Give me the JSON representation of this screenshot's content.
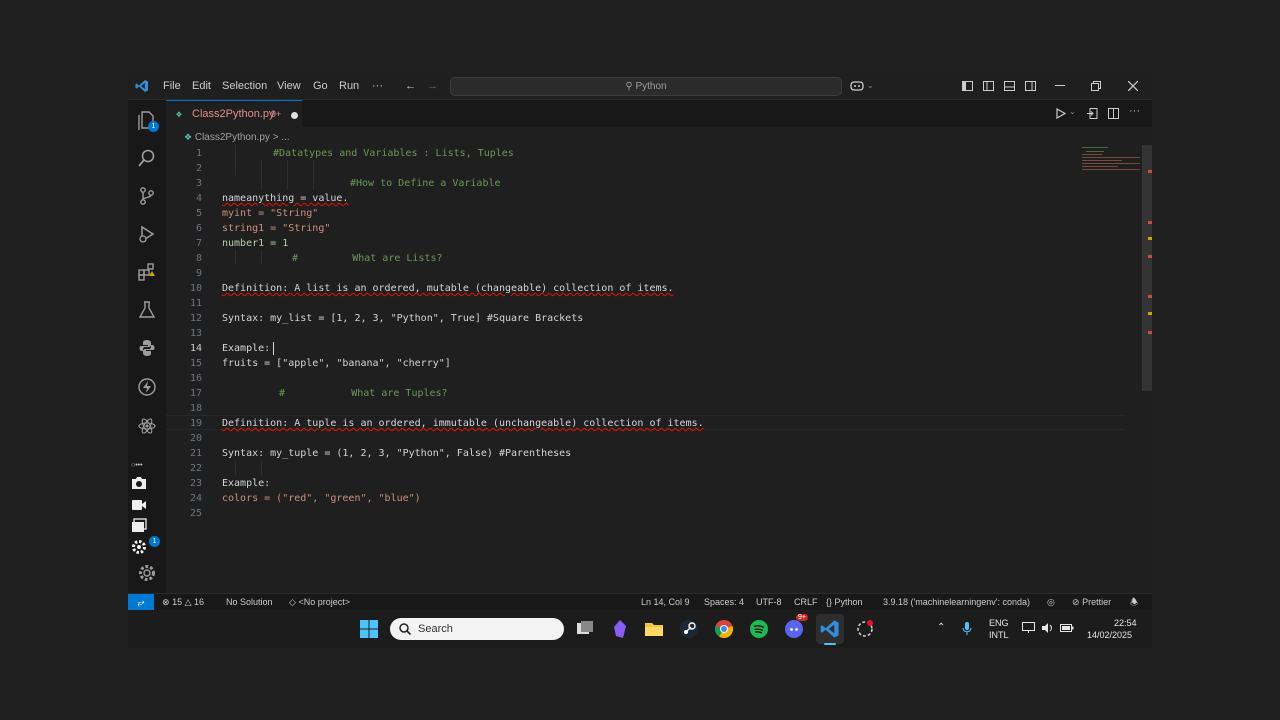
{
  "menu": {
    "items": [
      "File",
      "Edit",
      "Selection",
      "View",
      "Go",
      "Run",
      "···"
    ]
  },
  "command_center": {
    "text": "Python"
  },
  "activity": {
    "explorer_badge": "1",
    "settings_badge": "1"
  },
  "tab": {
    "name": "Class2Python.py",
    "meta": "9+"
  },
  "breadcrumb": {
    "file": "Class2Python.py",
    "rest": "> ..."
  },
  "editor": {
    "lines": [
      {
        "n": "1",
        "text": "#Datatypes and Variables : Lists, Tuples"
      },
      {
        "n": "2",
        "text": ""
      },
      {
        "n": "3",
        "text": "#How to Define a Variable"
      },
      {
        "n": "4",
        "text": "nameanything = value."
      },
      {
        "n": "5",
        "text": "myint = \"String\""
      },
      {
        "n": "6",
        "text": "string1 = \"String\""
      },
      {
        "n": "7",
        "text": "number1 = 1"
      },
      {
        "n": "8",
        "text": "#         What are Lists?"
      },
      {
        "n": "9",
        "text": ""
      },
      {
        "n": "10",
        "text": "Definition: A list is an ordered, mutable (changeable) collection of items."
      },
      {
        "n": "11",
        "text": ""
      },
      {
        "n": "12",
        "text": "Syntax: my_list = [1, 2, 3, \"Python\", True] #Square Brackets"
      },
      {
        "n": "13",
        "text": ""
      },
      {
        "n": "14",
        "text": "Example:"
      },
      {
        "n": "15",
        "text": "fruits = [\"apple\", \"banana\", \"cherry\"]"
      },
      {
        "n": "16",
        "text": ""
      },
      {
        "n": "17",
        "text": "#           What are Tuples?"
      },
      {
        "n": "18",
        "text": ""
      },
      {
        "n": "19",
        "text": "Definition: A tuple is an ordered, immutable (unchangeable) collection of items."
      },
      {
        "n": "20",
        "text": ""
      },
      {
        "n": "21",
        "text": "Syntax: my_tuple = (1, 2, 3, \"Python\", False) #Parentheses"
      },
      {
        "n": "22",
        "text": ""
      },
      {
        "n": "23",
        "text": "Example:"
      },
      {
        "n": "24",
        "text": "colors = (\"red\", \"green\", \"blue\")"
      },
      {
        "n": "25",
        "text": ""
      }
    ]
  },
  "status": {
    "errors": "15",
    "warnings": "16",
    "solution": "No Solution",
    "project": "<No project>",
    "position": "Ln 14, Col 9",
    "spaces": "Spaces: 4",
    "encoding": "UTF-8",
    "eol": "CRLF",
    "language": "Python",
    "interpreter": "3.9.18 ('machinelearningenv': conda)",
    "formatter": "Prettier"
  },
  "taskbar": {
    "search_placeholder": "Search",
    "discord_badge": "9+",
    "lang": "ENG",
    "layout": "INTL",
    "time": "22:54",
    "date": "14/02/2025"
  },
  "colors": {
    "accent": "#0078d4",
    "comment": "#6a9955",
    "string": "#ce9178",
    "keyword": "#569cd6",
    "number": "#b5cea8"
  }
}
